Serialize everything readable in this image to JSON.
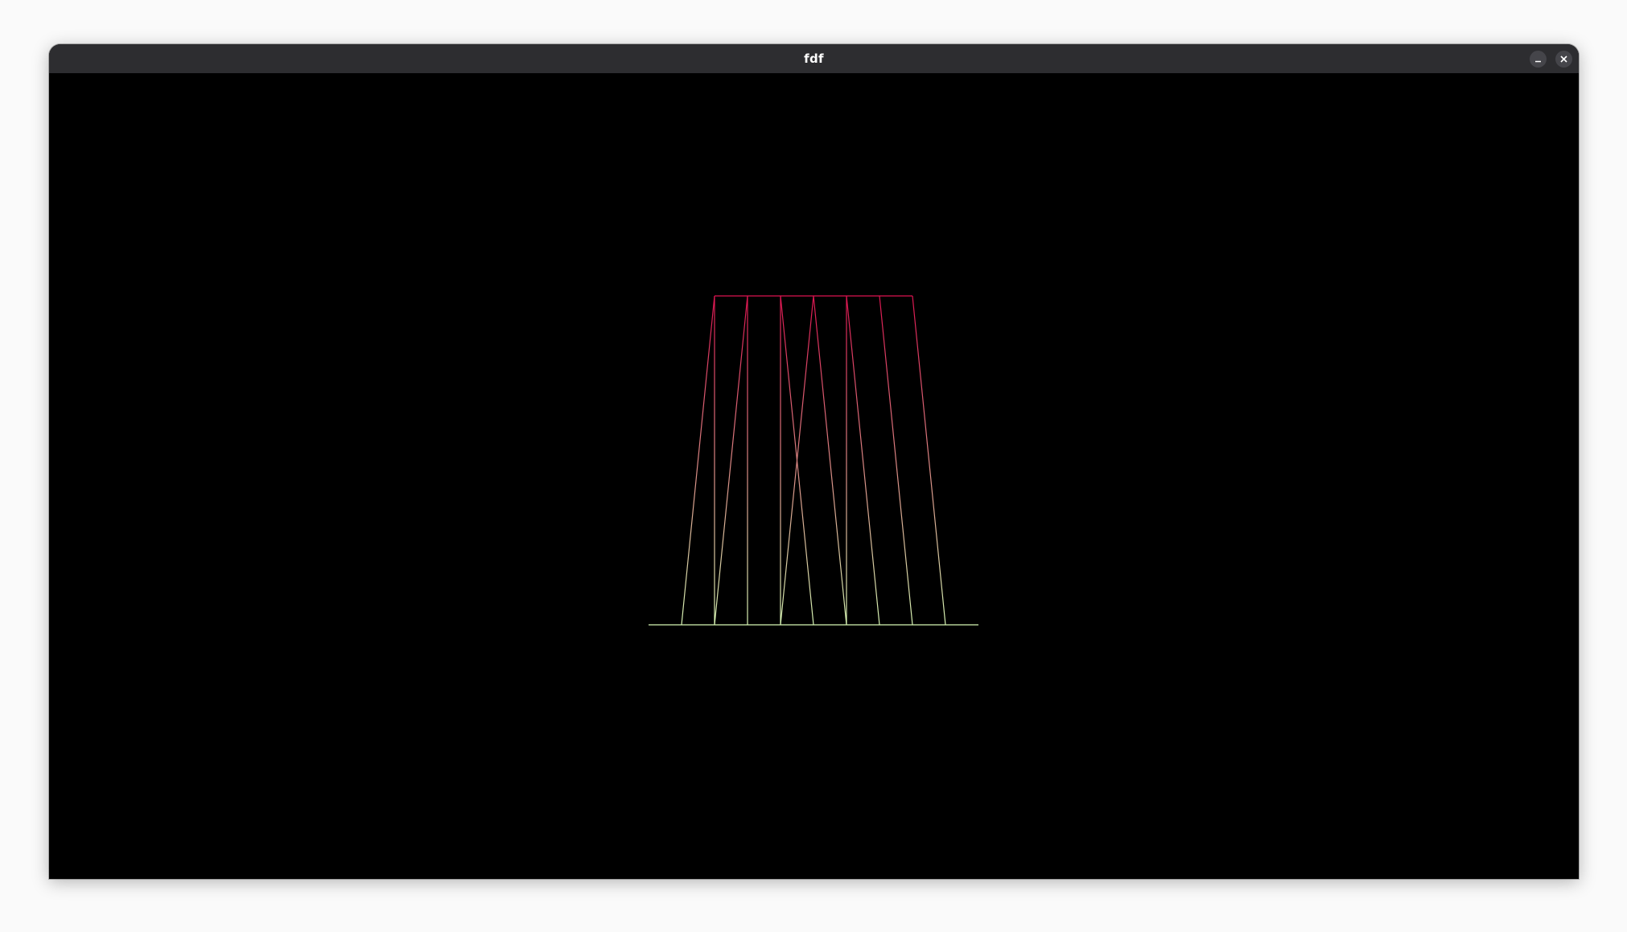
{
  "window": {
    "title": "fdf",
    "controls": [
      {
        "name": "minimize",
        "icon": "minimize-icon"
      },
      {
        "name": "close",
        "icon": "close-icon"
      }
    ]
  },
  "render": {
    "background": "#000000",
    "top_color": "#dc1450",
    "bottom_color": "#d7f5b4"
  }
}
